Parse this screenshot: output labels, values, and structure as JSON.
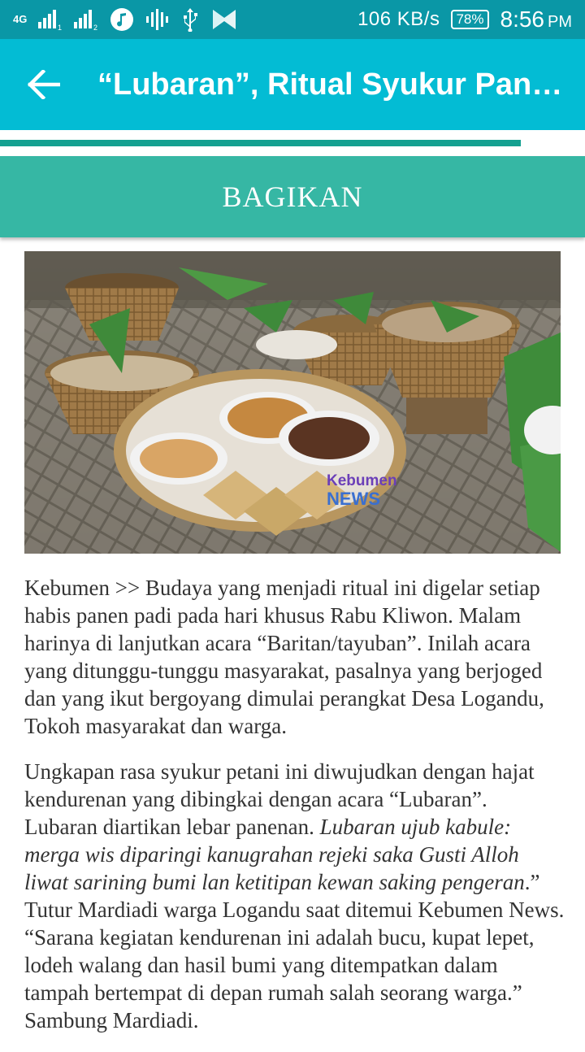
{
  "status_bar": {
    "network_type": "4G",
    "sim1": "1",
    "sim2": "2",
    "speed": "106 KB/s",
    "battery": "78%",
    "time": "8:56",
    "ampm": "PM",
    "icons": [
      "signal-icon",
      "music-icon",
      "audio-icon",
      "usb-icon",
      "app-icon"
    ],
    "background": "#0a97a6"
  },
  "app_bar": {
    "title": "“Lubaran”, Ritual Syukur Panen…",
    "background": "#03bcd4"
  },
  "progress": {
    "value": 0.89,
    "color": "#14a090"
  },
  "share": {
    "label": "BAGIKAN",
    "background": "#36b7a4"
  },
  "image": {
    "watermark_line1": "Kebumen",
    "watermark_line2": "NEWS"
  },
  "article": {
    "p1": "Kebumen >> Budaya yang menjadi ritual ini digelar setiap habis panen padi pada hari khusus Rabu Kliwon. Malam harinya di lanjutkan acara “Baritan/tayuban”. Inilah acara yang ditunggu-tunggu masyarakat, pasalnya yang berjoged dan yang ikut bergoyang dimulai perangkat Desa Logandu, Tokoh masyarakat dan warga.",
    "p2_a": "Ungkapan rasa syukur petani ini diwujudkan dengan hajat kendurenan yang dibingkai dengan acara “Lubaran”. Lubaran diartikan lebar panenan. ",
    "p2_italic": "Lubaran ujub kabule: merga wis diparingi kanugrahan rejeki saka Gusti Alloh liwat sarining bumi lan ketitipan kewan saking pengeran",
    "p2_b": ".” Tutur Mardiadi warga Logandu saat ditemui Kebumen News. “Sarana kegiatan kendurenan ini adalah bucu, kupat lepet, lodeh walang dan hasil bumi yang ditempatkan dalam tampah bertempat di depan rumah salah seorang warga.” Sambung Mardiadi."
  }
}
